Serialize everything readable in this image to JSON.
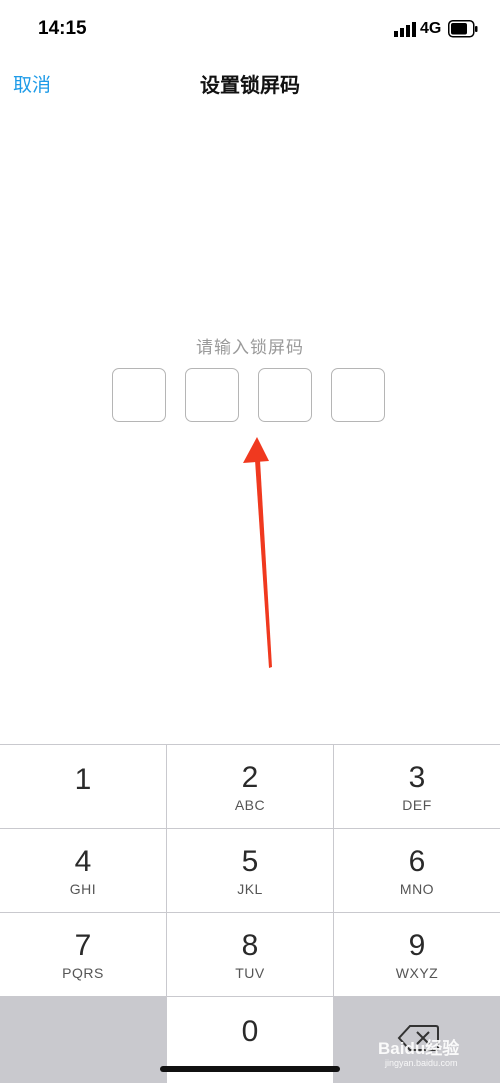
{
  "status_bar": {
    "time": "14:15",
    "network": "4G"
  },
  "nav": {
    "cancel_label": "取消",
    "title": "设置锁屏码"
  },
  "prompt": {
    "label": "请输入锁屏码"
  },
  "code_boxes": [
    {
      "value": ""
    },
    {
      "value": ""
    },
    {
      "value": ""
    },
    {
      "value": ""
    }
  ],
  "keypad": {
    "keys": [
      {
        "digit": "1",
        "letters": ""
      },
      {
        "digit": "2",
        "letters": "ABC"
      },
      {
        "digit": "3",
        "letters": "DEF"
      },
      {
        "digit": "4",
        "letters": "GHI"
      },
      {
        "digit": "5",
        "letters": "JKL"
      },
      {
        "digit": "6",
        "letters": "MNO"
      },
      {
        "digit": "7",
        "letters": "PQRS"
      },
      {
        "digit": "8",
        "letters": "TUV"
      },
      {
        "digit": "9",
        "letters": "WXYZ"
      },
      {
        "digit": "0",
        "letters": ""
      }
    ]
  },
  "watermark": {
    "text": "Baidu经验",
    "sub": "jingyan.baidu.com"
  },
  "colors": {
    "accent": "#1e9be8",
    "annotation": "#f0391f",
    "keypad_bg": "#c9c9ce"
  }
}
